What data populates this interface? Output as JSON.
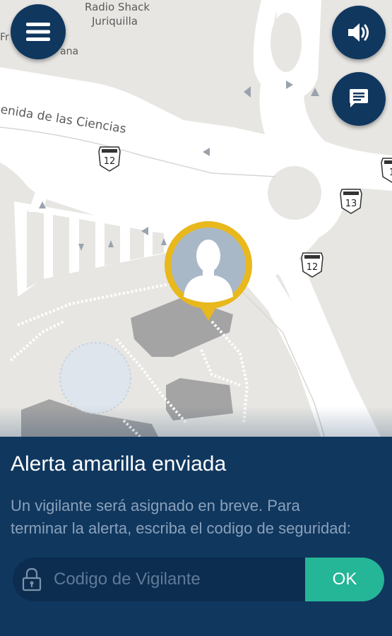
{
  "map": {
    "labels": {
      "radio_shack_line1": "Radio Shack",
      "radio_shack_line2": "Juriquilla",
      "plaza_line1": "Fr    Comercial",
      "plaza_line2": "ana",
      "street": "enida de las Ciencias"
    },
    "route_badges": [
      "12",
      "13",
      "12",
      "1"
    ],
    "marker": {
      "icon": "user-avatar-icon",
      "ring_color": "#e8b81c"
    }
  },
  "buttons": {
    "menu_icon": "hamburger-menu-icon",
    "sound_icon": "speaker-icon",
    "chat_icon": "chat-message-icon"
  },
  "panel": {
    "title": "Alerta amarilla enviada",
    "message_line1": "Un vigilante será asignado en breve. Para",
    "message_line2": "terminar la alerta, escriba el codigo de seguridad:",
    "code_placeholder": "Codigo de Vigilante",
    "ok_label": "OK",
    "colors": {
      "panel_bg": "#10375e",
      "accent": "#25b597"
    }
  }
}
